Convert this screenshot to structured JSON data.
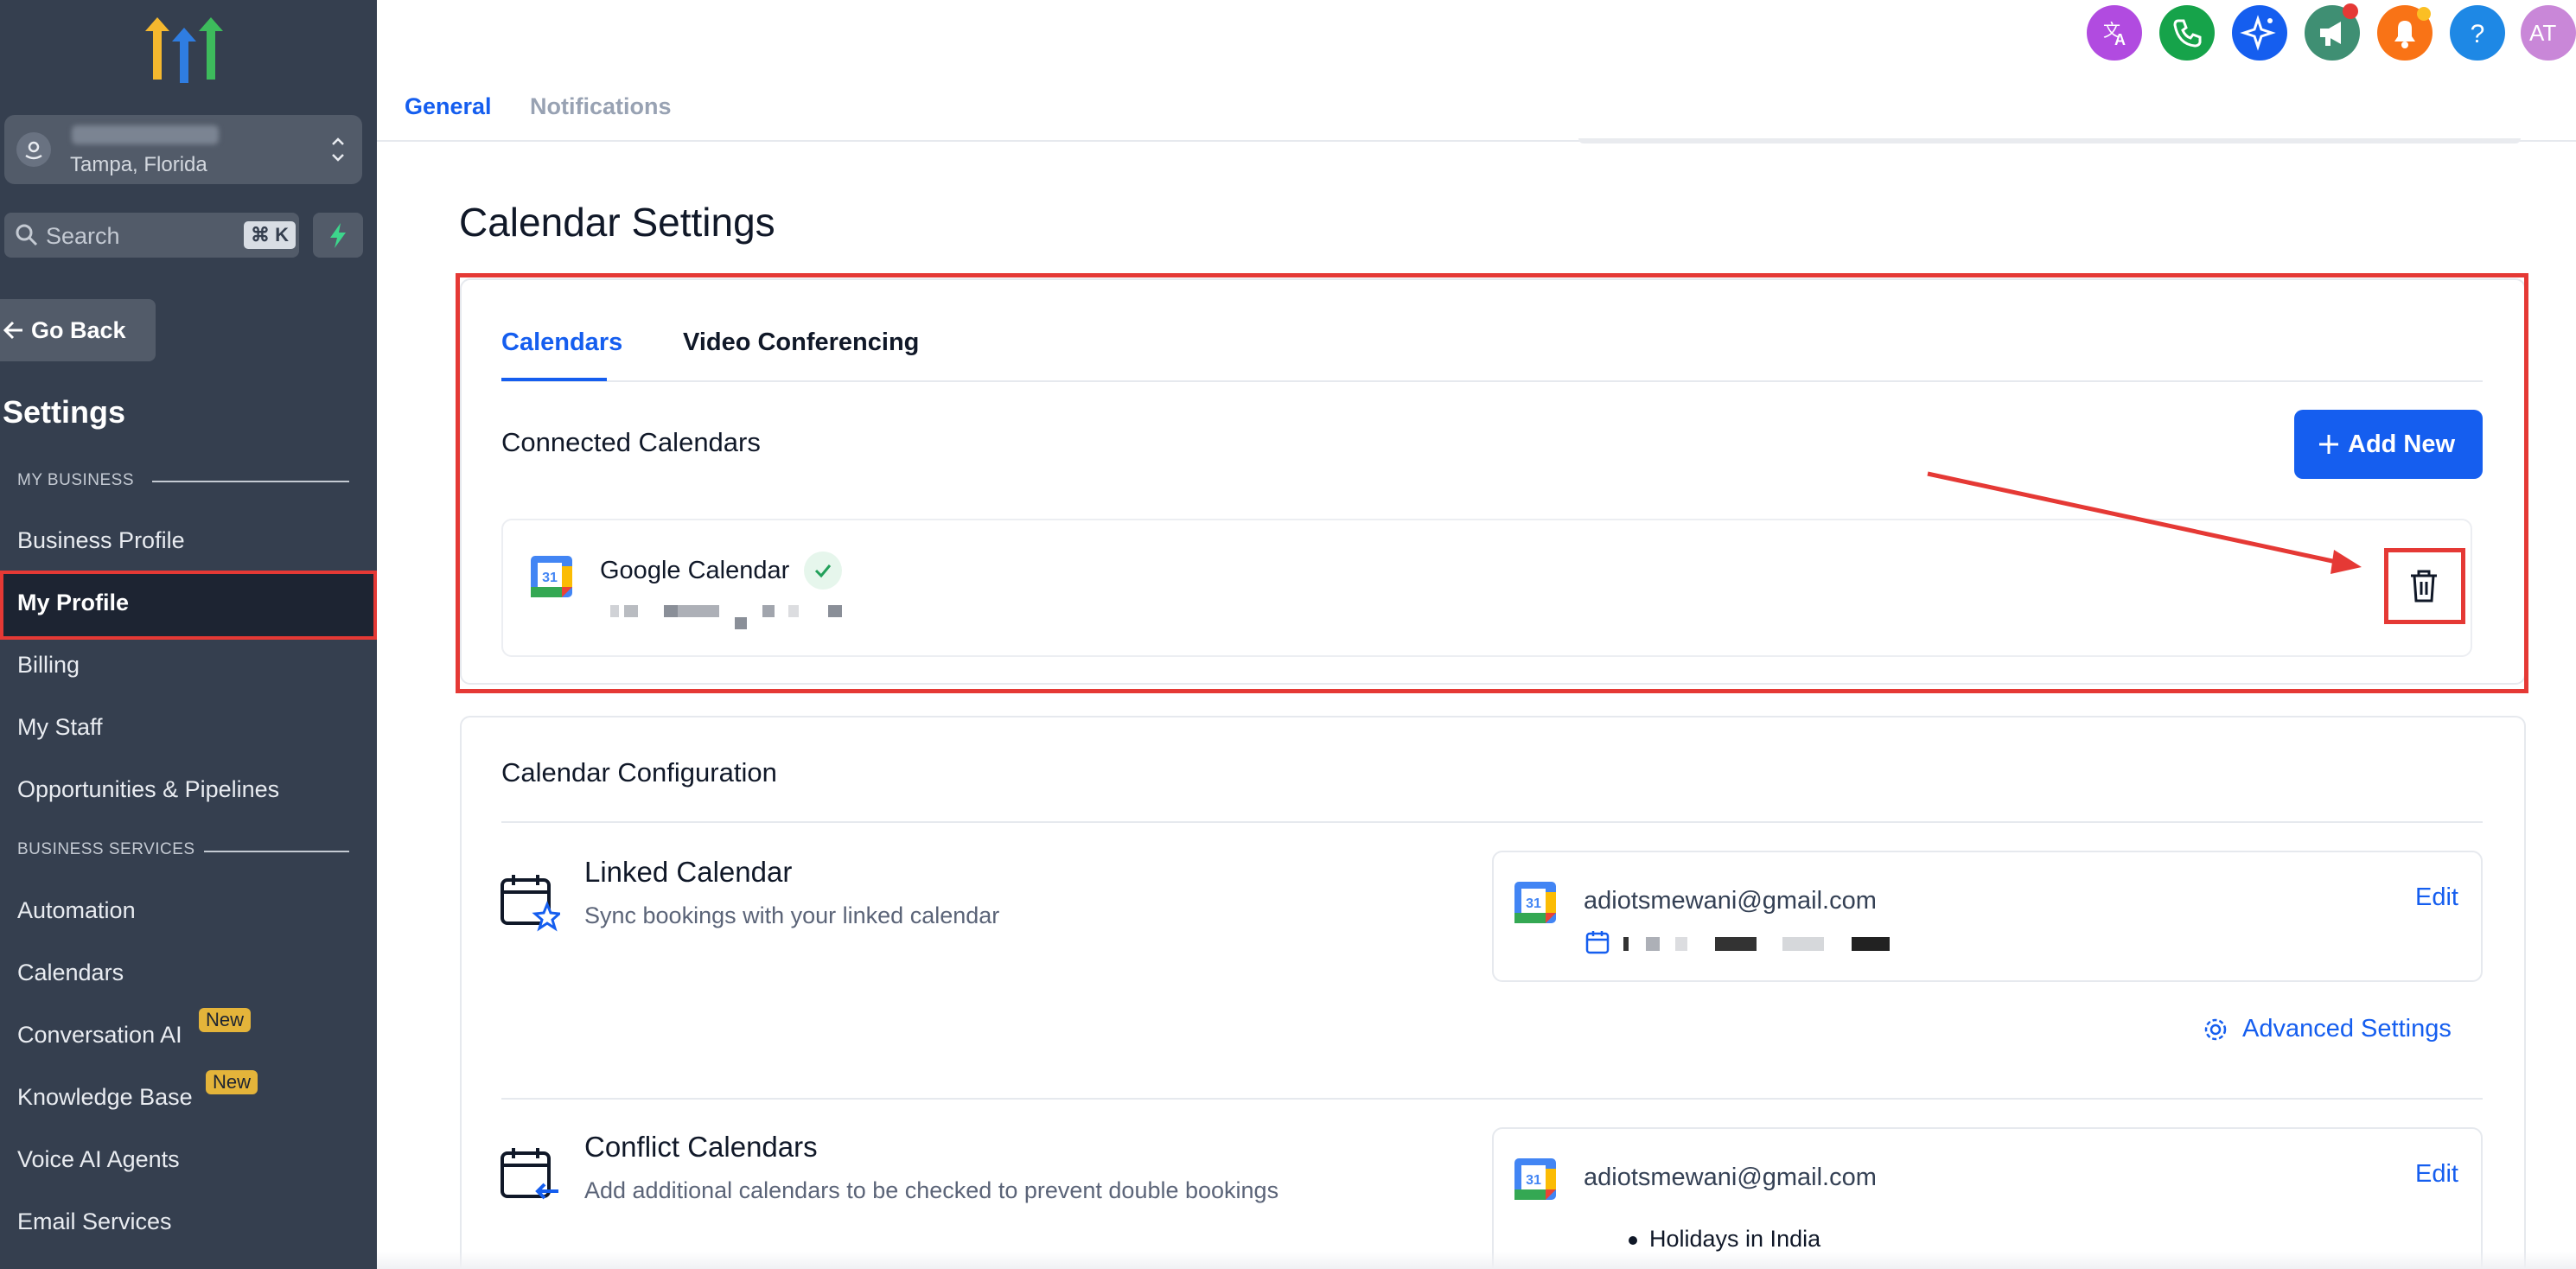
{
  "sidebar": {
    "location_city": "Tampa, Florida",
    "search_placeholder": "Search",
    "search_shortcut": "⌘ K",
    "go_back": "Go Back",
    "title": "Settings",
    "sections": [
      {
        "label": "MY BUSINESS",
        "items": [
          {
            "label": "Business Profile"
          },
          {
            "label": "My Profile",
            "active": true
          },
          {
            "label": "Billing"
          },
          {
            "label": "My Staff"
          },
          {
            "label": "Opportunities & Pipelines"
          }
        ]
      },
      {
        "label": "BUSINESS SERVICES",
        "items": [
          {
            "label": "Automation"
          },
          {
            "label": "Calendars"
          },
          {
            "label": "Conversation AI",
            "badge": "New"
          },
          {
            "label": "Knowledge Base",
            "badge": "New"
          },
          {
            "label": "Voice AI Agents"
          },
          {
            "label": "Email Services"
          }
        ]
      }
    ]
  },
  "topbar": {
    "icons": [
      {
        "name": "translate-icon",
        "color": "#b14be0"
      },
      {
        "name": "phone-icon",
        "color": "#16a34a"
      },
      {
        "name": "ai-sparkle-icon",
        "color": "#155eef"
      },
      {
        "name": "megaphone-icon",
        "color": "#3f8f73"
      },
      {
        "name": "bell-icon",
        "color": "#f97316"
      },
      {
        "name": "help-icon",
        "color": "#1e88e5"
      }
    ],
    "avatar_initials": "AT",
    "tabs": [
      "General",
      "Notifications"
    ]
  },
  "page": {
    "title": "Calendar Settings",
    "calendar_tabs": [
      "Calendars",
      "Video Conferencing"
    ],
    "connected": {
      "title": "Connected Calendars",
      "add_new": "Add New",
      "calendar_name": "Google Calendar",
      "calendar_icon_text": "31"
    },
    "configuration": {
      "title": "Calendar Configuration",
      "linked": {
        "title": "Linked Calendar",
        "subtitle": "Sync bookings with your linked calendar",
        "email": "adiotsmewani@gmail.com",
        "edit": "Edit"
      },
      "advanced_settings": "Advanced Settings",
      "conflict": {
        "title": "Conflict Calendars",
        "subtitle": "Add additional calendars to be checked to prevent double bookings",
        "email": "adiotsmewani@gmail.com",
        "edit": "Edit",
        "items": [
          "Holidays in India"
        ]
      }
    }
  },
  "colors": {
    "sidebar_bg": "#353f4f",
    "accent": "#155eef",
    "highlight_red": "#e53935",
    "badge_yellow": "#e4b43a"
  }
}
